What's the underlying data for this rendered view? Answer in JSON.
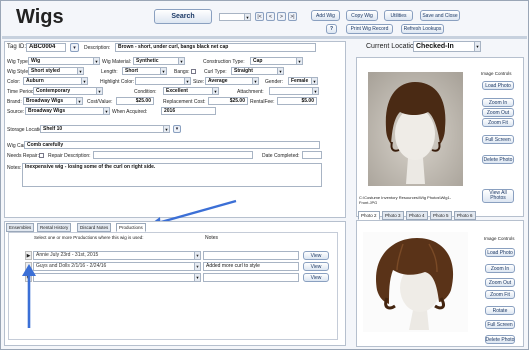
{
  "app": {
    "title": "Wigs"
  },
  "toolbar": {
    "search": "Search",
    "add": "Add Wig",
    "copy": "Copy Wig",
    "utilities": "Utilities",
    "save_close": "Save and Close",
    "help": "?",
    "print": "Print Wig Record",
    "refresh": "Refresh Lookups",
    "nav": [
      "|<",
      "<",
      ">",
      ">|"
    ]
  },
  "form": {
    "tag_id_label": "Tag ID:",
    "tag_id": "ABC0004",
    "description_label": "Description:",
    "description": "Brown - short, under curl, bangs black net cap",
    "wig_type_label": "Wig Type:",
    "wig_type": "Wig",
    "wig_material_label": "Wig Material:",
    "wig_material": "Synthetic",
    "construction_type_label": "Construction Type:",
    "construction_type": "Cap",
    "wig_style_label": "Wig Style:",
    "wig_style": "Short styled",
    "length_label": "Length:",
    "length": "Short",
    "bangs_label": "Bangs:",
    "curl_type_label": "Curl Type:",
    "curl_type": "Straight",
    "color_label": "Color:",
    "color": "Auburn",
    "highlight_color_label": "Highlight Color:",
    "size_label": "Size:",
    "size": "Average",
    "gender_label": "Gender:",
    "gender": "Female",
    "time_period_label": "Time Period:",
    "time_period": "Contemporary",
    "condition_label": "Condition:",
    "condition": "Excellent",
    "attachment_label": "Attachment:",
    "brand_label": "Brand:",
    "brand": "Broadway Wigs",
    "cost_label": "Cost/Value:",
    "cost": "$25.00",
    "replacement_label": "Replacement Cost:",
    "replacement": "$25.00",
    "rental_label": "RentalFee:",
    "rental": "$5.00",
    "source_label": "Source:",
    "source": "Broadway Wigs",
    "acquired_label": "When Acquired:",
    "acquired": "2016",
    "storage_label": "Storage Location:",
    "storage": "Shelf 10",
    "care_label": "Wig Care:",
    "care": "Comb carefully",
    "repair_label": "Needs Repair:",
    "repair_desc_label": "Repair Description:",
    "date_completed_label": "Date Completed:",
    "notes_label": "Notes:",
    "notes": "Inexpensive wig - losing some of the curl on right side."
  },
  "location": {
    "label": "Current Location:",
    "value": "Checked-In"
  },
  "image_controls": {
    "title": "Image Controls",
    "buttons": [
      "Load Photo",
      "Zoom In",
      "Zoom Out",
      "Zoom Fit",
      "Full Screen",
      "Delete Photo"
    ],
    "view_all": "View All Photos",
    "caption": "C:\\Costume Inventory Resources\\Wig Photos\\Wig1-Front.JPG"
  },
  "photo_tabs": [
    "Photo 2",
    "Photo 3",
    "Photo 4",
    "Photo 5",
    "Photo 6"
  ],
  "image_controls2": {
    "title": "Image Controls",
    "buttons": [
      "Load Photo",
      "Zoom In",
      "Zoom Out",
      "Zoom Fit",
      "Rotate",
      "Full Screen",
      "Delete Photo"
    ]
  },
  "bottom_tabs": [
    "Ensembles",
    "Rental History",
    "Discard Notes",
    "Productions"
  ],
  "productions": {
    "instructions": "Select one or more Productions where this wig is used:",
    "notes_header": "Notes",
    "rows": [
      {
        "name": "Annie July 23rd - 31st, 2015",
        "note": "",
        "view": "View"
      },
      {
        "name": "Guys and Dolls 2/1/16 - 2/24/16",
        "note": "Added more curl to style",
        "view": "View"
      },
      {
        "name": "",
        "note": "",
        "view": "View"
      }
    ]
  }
}
